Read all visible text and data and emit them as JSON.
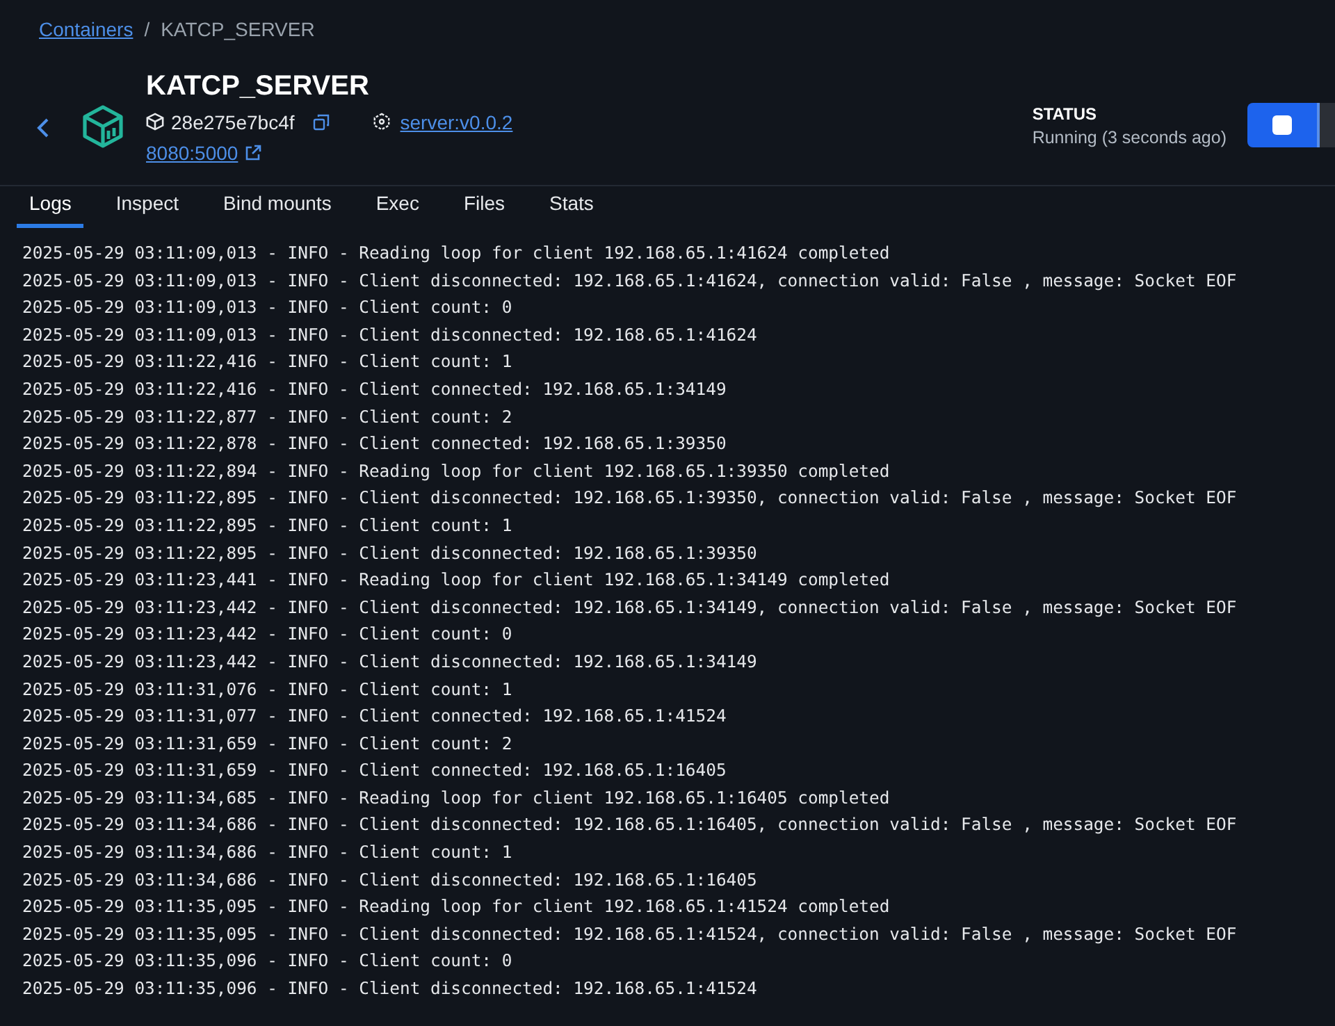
{
  "breadcrumb": {
    "link": "Containers",
    "separator": "/",
    "current": "KATCP_SERVER"
  },
  "container": {
    "name": "KATCP_SERVER",
    "id": "28e275e7bc4f",
    "image": "server:v0.0.2",
    "port": "8080:5000"
  },
  "status": {
    "label": "STATUS",
    "value": "Running (3 seconds ago)"
  },
  "tabs": [
    {
      "label": "Logs",
      "selected": true
    },
    {
      "label": "Inspect",
      "selected": false
    },
    {
      "label": "Bind mounts",
      "selected": false
    },
    {
      "label": "Exec",
      "selected": false
    },
    {
      "label": "Files",
      "selected": false
    },
    {
      "label": "Stats",
      "selected": false
    }
  ],
  "logs": [
    "2025-05-29 03:11:09,013 - INFO - Reading loop for client 192.168.65.1:41624 completed",
    "2025-05-29 03:11:09,013 - INFO - Client disconnected: 192.168.65.1:41624, connection valid: False , message: Socket EOF",
    "2025-05-29 03:11:09,013 - INFO - Client count: 0",
    "2025-05-29 03:11:09,013 - INFO - Client disconnected: 192.168.65.1:41624",
    "2025-05-29 03:11:22,416 - INFO - Client count: 1",
    "2025-05-29 03:11:22,416 - INFO - Client connected: 192.168.65.1:34149",
    "2025-05-29 03:11:22,877 - INFO - Client count: 2",
    "2025-05-29 03:11:22,878 - INFO - Client connected: 192.168.65.1:39350",
    "2025-05-29 03:11:22,894 - INFO - Reading loop for client 192.168.65.1:39350 completed",
    "2025-05-29 03:11:22,895 - INFO - Client disconnected: 192.168.65.1:39350, connection valid: False , message: Socket EOF",
    "2025-05-29 03:11:22,895 - INFO - Client count: 1",
    "2025-05-29 03:11:22,895 - INFO - Client disconnected: 192.168.65.1:39350",
    "2025-05-29 03:11:23,441 - INFO - Reading loop for client 192.168.65.1:34149 completed",
    "2025-05-29 03:11:23,442 - INFO - Client disconnected: 192.168.65.1:34149, connection valid: False , message: Socket EOF",
    "2025-05-29 03:11:23,442 - INFO - Client count: 0",
    "2025-05-29 03:11:23,442 - INFO - Client disconnected: 192.168.65.1:34149",
    "2025-05-29 03:11:31,076 - INFO - Client count: 1",
    "2025-05-29 03:11:31,077 - INFO - Client connected: 192.168.65.1:41524",
    "2025-05-29 03:11:31,659 - INFO - Client count: 2",
    "2025-05-29 03:11:31,659 - INFO - Client connected: 192.168.65.1:16405",
    "2025-05-29 03:11:34,685 - INFO - Reading loop for client 192.168.65.1:16405 completed",
    "2025-05-29 03:11:34,686 - INFO - Client disconnected: 192.168.65.1:16405, connection valid: False , message: Socket EOF",
    "2025-05-29 03:11:34,686 - INFO - Client count: 1",
    "2025-05-29 03:11:34,686 - INFO - Client disconnected: 192.168.65.1:16405",
    "2025-05-29 03:11:35,095 - INFO - Reading loop for client 192.168.65.1:41524 completed",
    "2025-05-29 03:11:35,095 - INFO - Client disconnected: 192.168.65.1:41524, connection valid: False , message: Socket EOF",
    "2025-05-29 03:11:35,096 - INFO - Client count: 0",
    "2025-05-29 03:11:35,096 - INFO - Client disconnected: 192.168.65.1:41524"
  ]
}
